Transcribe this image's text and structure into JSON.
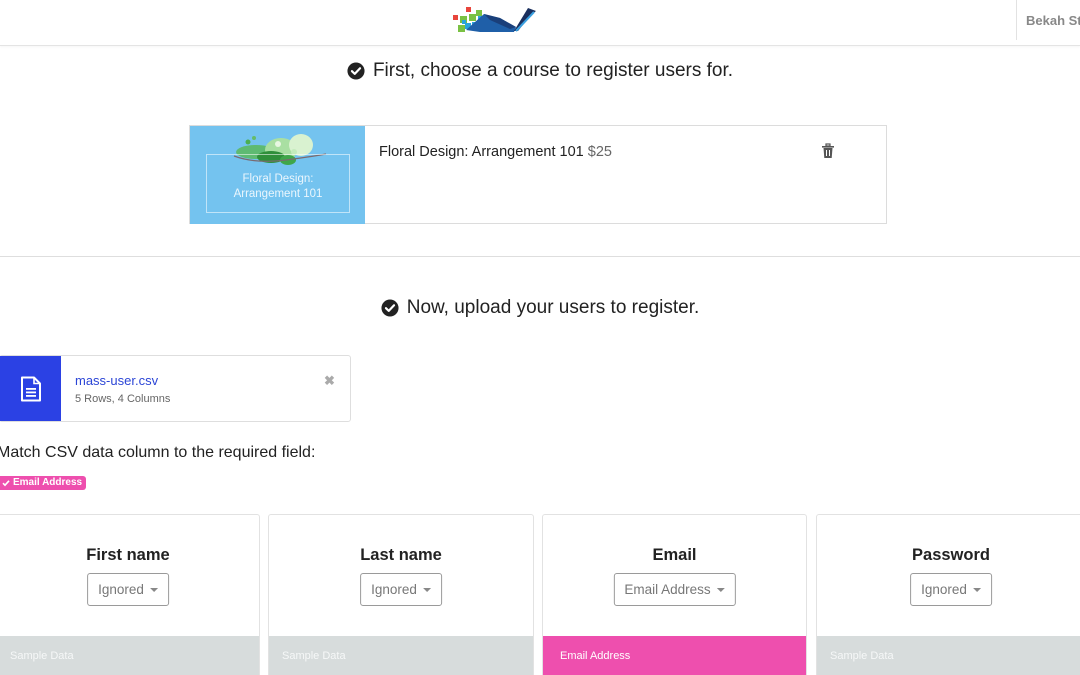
{
  "header": {
    "logo_icon": "brand-logo",
    "user_name": "Bekah St"
  },
  "step1": {
    "icon": "check-circle-icon",
    "title": "First, choose a course to register users for."
  },
  "course": {
    "thumbnail_text_line1": "Floral Design:",
    "thumbnail_text_line2": "Arrangement 101",
    "title": "Floral Design: Arrangement 101",
    "price": "$25",
    "remove_icon": "trash-icon",
    "thumbnail_color": "#74c3ef"
  },
  "step2": {
    "icon": "check-circle-icon",
    "title": "Now, upload your users to register."
  },
  "file": {
    "icon": "file-text-icon",
    "name": "mass-user.csv",
    "meta": "5 Rows, 4 Columns",
    "close_icon": "close-icon",
    "accent_color": "#2b41e4"
  },
  "matching": {
    "label": "Match CSV data column to the required field:",
    "required_badges": [
      {
        "icon": "check-icon",
        "label": "Email Address",
        "color": "#ee4fae"
      }
    ]
  },
  "columns": [
    {
      "title": "First name",
      "selected": "Ignored",
      "sample_label": "Sample Data",
      "active": false
    },
    {
      "title": "Last name",
      "selected": "Ignored",
      "sample_label": "Sample Data",
      "active": false
    },
    {
      "title": "Email",
      "selected": "Email Address",
      "sample_label": "Email Address",
      "active": true
    },
    {
      "title": "Password",
      "selected": "Ignored",
      "sample_label": "Sample Data",
      "active": false
    }
  ]
}
